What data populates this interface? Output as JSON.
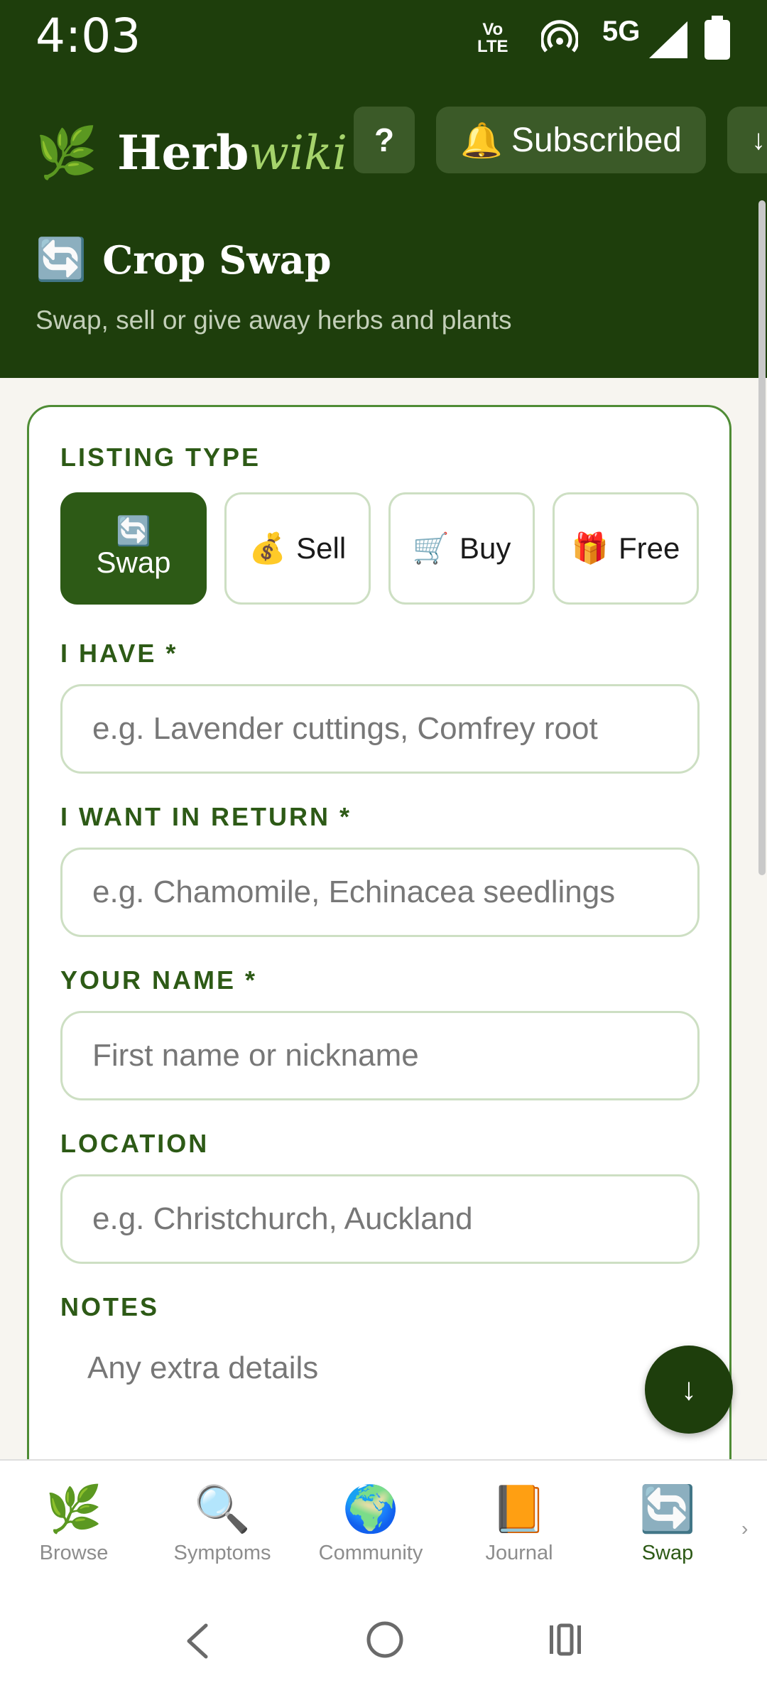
{
  "status_bar": {
    "time": "4:03",
    "volte_top": "Vo",
    "volte_bottom": "LTE",
    "network": "5G"
  },
  "header": {
    "brand_icon": "🌿",
    "brand_name": "Herb",
    "brand_suffix": "wiki",
    "help_label": "?",
    "subscribe_icon": "🔔",
    "subscribe_label": "Subscribed",
    "more_label": "↓",
    "page_icon": "🔄",
    "page_title": "Crop Swap",
    "page_subtitle": "Swap, sell or give away herbs and plants"
  },
  "form": {
    "listing_type_label": "LISTING TYPE",
    "types": [
      {
        "icon": "🔄",
        "label": "Swap",
        "selected": true
      },
      {
        "icon": "💰",
        "label": "Sell",
        "selected": false
      },
      {
        "icon": "🛒",
        "label": "Buy",
        "selected": false
      },
      {
        "icon": "🎁",
        "label": "Free",
        "selected": false
      }
    ],
    "have_label": "I HAVE *",
    "have_placeholder": "e.g. Lavender cuttings, Comfrey root",
    "want_label": "I WANT IN RETURN *",
    "want_placeholder": "e.g. Chamomile, Echinacea seedlings",
    "name_label": "YOUR NAME *",
    "name_placeholder": "First name or nickname",
    "location_label": "LOCATION",
    "location_placeholder": "e.g. Christchurch, Auckland",
    "notes_label": "NOTES",
    "notes_placeholder": "Any extra details"
  },
  "fab_label": "↓",
  "bottom_nav": [
    {
      "icon": "🌿",
      "label": "Browse",
      "active": false
    },
    {
      "icon": "🔍",
      "label": "Symptoms",
      "active": false
    },
    {
      "icon": "🌍",
      "label": "Community",
      "active": false
    },
    {
      "icon": "📙",
      "label": "Journal",
      "active": false
    },
    {
      "icon": "🔄",
      "label": "Swap",
      "active": true
    }
  ],
  "bottom_nav_more": "›",
  "colors": {
    "primary_dark": "#1e3e0c",
    "primary": "#2d5a16",
    "accent": "#a5d36b",
    "border": "#cddfc3"
  }
}
